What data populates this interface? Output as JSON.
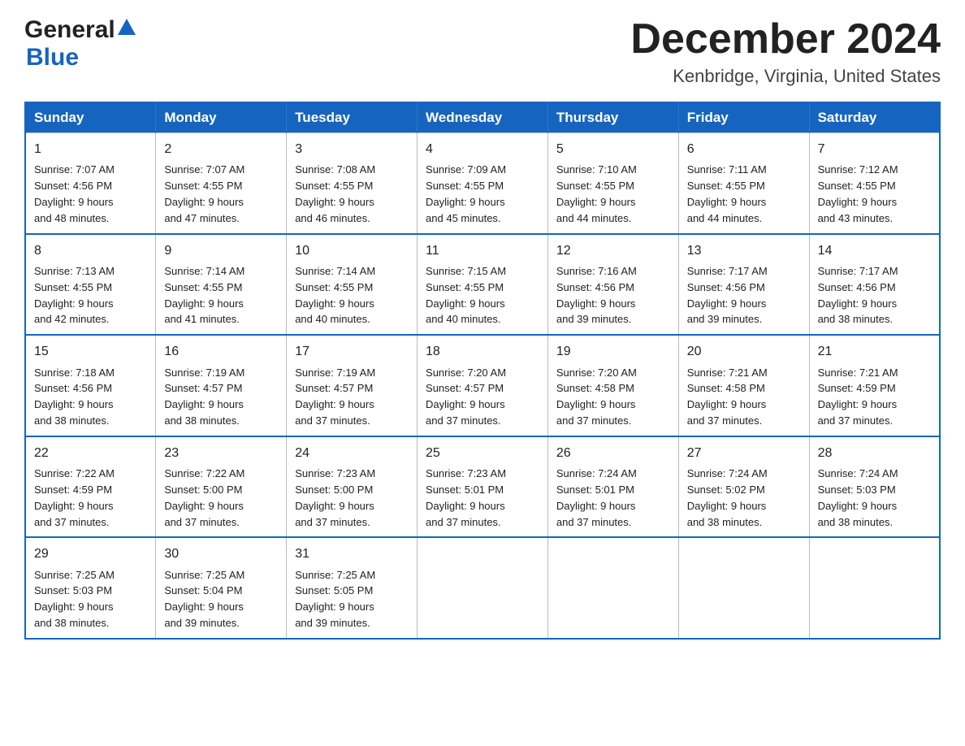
{
  "header": {
    "logo_general": "General",
    "logo_blue": "Blue",
    "title": "December 2024",
    "subtitle": "Kenbridge, Virginia, United States"
  },
  "days_of_week": [
    "Sunday",
    "Monday",
    "Tuesday",
    "Wednesday",
    "Thursday",
    "Friday",
    "Saturday"
  ],
  "weeks": [
    [
      {
        "day": "1",
        "sunrise": "7:07 AM",
        "sunset": "4:56 PM",
        "daylight": "9 hours and 48 minutes."
      },
      {
        "day": "2",
        "sunrise": "7:07 AM",
        "sunset": "4:55 PM",
        "daylight": "9 hours and 47 minutes."
      },
      {
        "day": "3",
        "sunrise": "7:08 AM",
        "sunset": "4:55 PM",
        "daylight": "9 hours and 46 minutes."
      },
      {
        "day": "4",
        "sunrise": "7:09 AM",
        "sunset": "4:55 PM",
        "daylight": "9 hours and 45 minutes."
      },
      {
        "day": "5",
        "sunrise": "7:10 AM",
        "sunset": "4:55 PM",
        "daylight": "9 hours and 44 minutes."
      },
      {
        "day": "6",
        "sunrise": "7:11 AM",
        "sunset": "4:55 PM",
        "daylight": "9 hours and 44 minutes."
      },
      {
        "day": "7",
        "sunrise": "7:12 AM",
        "sunset": "4:55 PM",
        "daylight": "9 hours and 43 minutes."
      }
    ],
    [
      {
        "day": "8",
        "sunrise": "7:13 AM",
        "sunset": "4:55 PM",
        "daylight": "9 hours and 42 minutes."
      },
      {
        "day": "9",
        "sunrise": "7:14 AM",
        "sunset": "4:55 PM",
        "daylight": "9 hours and 41 minutes."
      },
      {
        "day": "10",
        "sunrise": "7:14 AM",
        "sunset": "4:55 PM",
        "daylight": "9 hours and 40 minutes."
      },
      {
        "day": "11",
        "sunrise": "7:15 AM",
        "sunset": "4:55 PM",
        "daylight": "9 hours and 40 minutes."
      },
      {
        "day": "12",
        "sunrise": "7:16 AM",
        "sunset": "4:56 PM",
        "daylight": "9 hours and 39 minutes."
      },
      {
        "day": "13",
        "sunrise": "7:17 AM",
        "sunset": "4:56 PM",
        "daylight": "9 hours and 39 minutes."
      },
      {
        "day": "14",
        "sunrise": "7:17 AM",
        "sunset": "4:56 PM",
        "daylight": "9 hours and 38 minutes."
      }
    ],
    [
      {
        "day": "15",
        "sunrise": "7:18 AM",
        "sunset": "4:56 PM",
        "daylight": "9 hours and 38 minutes."
      },
      {
        "day": "16",
        "sunrise": "7:19 AM",
        "sunset": "4:57 PM",
        "daylight": "9 hours and 38 minutes."
      },
      {
        "day": "17",
        "sunrise": "7:19 AM",
        "sunset": "4:57 PM",
        "daylight": "9 hours and 37 minutes."
      },
      {
        "day": "18",
        "sunrise": "7:20 AM",
        "sunset": "4:57 PM",
        "daylight": "9 hours and 37 minutes."
      },
      {
        "day": "19",
        "sunrise": "7:20 AM",
        "sunset": "4:58 PM",
        "daylight": "9 hours and 37 minutes."
      },
      {
        "day": "20",
        "sunrise": "7:21 AM",
        "sunset": "4:58 PM",
        "daylight": "9 hours and 37 minutes."
      },
      {
        "day": "21",
        "sunrise": "7:21 AM",
        "sunset": "4:59 PM",
        "daylight": "9 hours and 37 minutes."
      }
    ],
    [
      {
        "day": "22",
        "sunrise": "7:22 AM",
        "sunset": "4:59 PM",
        "daylight": "9 hours and 37 minutes."
      },
      {
        "day": "23",
        "sunrise": "7:22 AM",
        "sunset": "5:00 PM",
        "daylight": "9 hours and 37 minutes."
      },
      {
        "day": "24",
        "sunrise": "7:23 AM",
        "sunset": "5:00 PM",
        "daylight": "9 hours and 37 minutes."
      },
      {
        "day": "25",
        "sunrise": "7:23 AM",
        "sunset": "5:01 PM",
        "daylight": "9 hours and 37 minutes."
      },
      {
        "day": "26",
        "sunrise": "7:24 AM",
        "sunset": "5:01 PM",
        "daylight": "9 hours and 37 minutes."
      },
      {
        "day": "27",
        "sunrise": "7:24 AM",
        "sunset": "5:02 PM",
        "daylight": "9 hours and 38 minutes."
      },
      {
        "day": "28",
        "sunrise": "7:24 AM",
        "sunset": "5:03 PM",
        "daylight": "9 hours and 38 minutes."
      }
    ],
    [
      {
        "day": "29",
        "sunrise": "7:25 AM",
        "sunset": "5:03 PM",
        "daylight": "9 hours and 38 minutes."
      },
      {
        "day": "30",
        "sunrise": "7:25 AM",
        "sunset": "5:04 PM",
        "daylight": "9 hours and 39 minutes."
      },
      {
        "day": "31",
        "sunrise": "7:25 AM",
        "sunset": "5:05 PM",
        "daylight": "9 hours and 39 minutes."
      },
      null,
      null,
      null,
      null
    ]
  ],
  "labels": {
    "sunrise": "Sunrise:",
    "sunset": "Sunset:",
    "daylight": "Daylight:"
  },
  "colors": {
    "header_bg": "#1565c0",
    "header_text": "#ffffff",
    "border": "#1565c0",
    "cell_border": "#bbbbbb"
  }
}
